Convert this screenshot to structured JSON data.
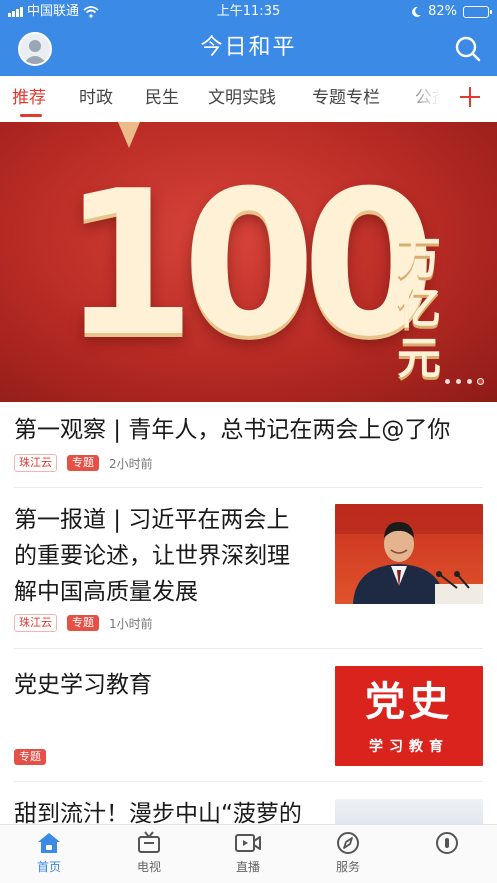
{
  "status_bar": {
    "carrier": "中国联通",
    "time": "上午11:35",
    "battery": "82%",
    "battery_level": 0.82
  },
  "app_bar": {
    "title": "今日和平",
    "avatar_icon": "user-avatar-icon",
    "search_icon": "search-icon"
  },
  "tabs": [
    {
      "label": "推荐",
      "active": true
    },
    {
      "label": "时政",
      "active": false
    },
    {
      "label": "民生",
      "active": false
    },
    {
      "label": "文明实践",
      "active": false
    },
    {
      "label": "专题专栏",
      "active": false
    },
    {
      "label": "公益",
      "active": false
    }
  ],
  "banner": {
    "big_text": "100",
    "side_text": "万亿元",
    "page_count": 4,
    "active_page": 4
  },
  "news": [
    {
      "title": "第一观察 | 青年人，总书记在两会上@了你",
      "source": "珠江云",
      "tag": "专题",
      "time": "2小时前"
    },
    {
      "title_lines": [
        "第一报道 | 习近平在两会上",
        "的重要论述，让世界深刻理",
        "解中国高质量发展"
      ],
      "source": "珠江云",
      "tag": "专题",
      "time": "1小时前"
    },
    {
      "title": "党史学习教育",
      "tag": "专题",
      "thumb_big": "党史",
      "thumb_small": "学习教育"
    },
    {
      "title": "甜到流汁！漫步中山“菠萝的"
    }
  ],
  "bottom_nav": [
    {
      "label": "首页",
      "icon": "home-icon",
      "active": true
    },
    {
      "label": "电视",
      "icon": "tv-icon",
      "active": false
    },
    {
      "label": "直播",
      "icon": "live-video-icon",
      "active": false
    },
    {
      "label": "服务",
      "icon": "compass-icon",
      "active": false
    },
    {
      "label": "",
      "icon": "profile-icon",
      "active": false
    }
  ],
  "colors": {
    "brand_blue": "#3a8ae6",
    "accent_red": "#e23a2e",
    "banner_red": "#b72a24"
  }
}
